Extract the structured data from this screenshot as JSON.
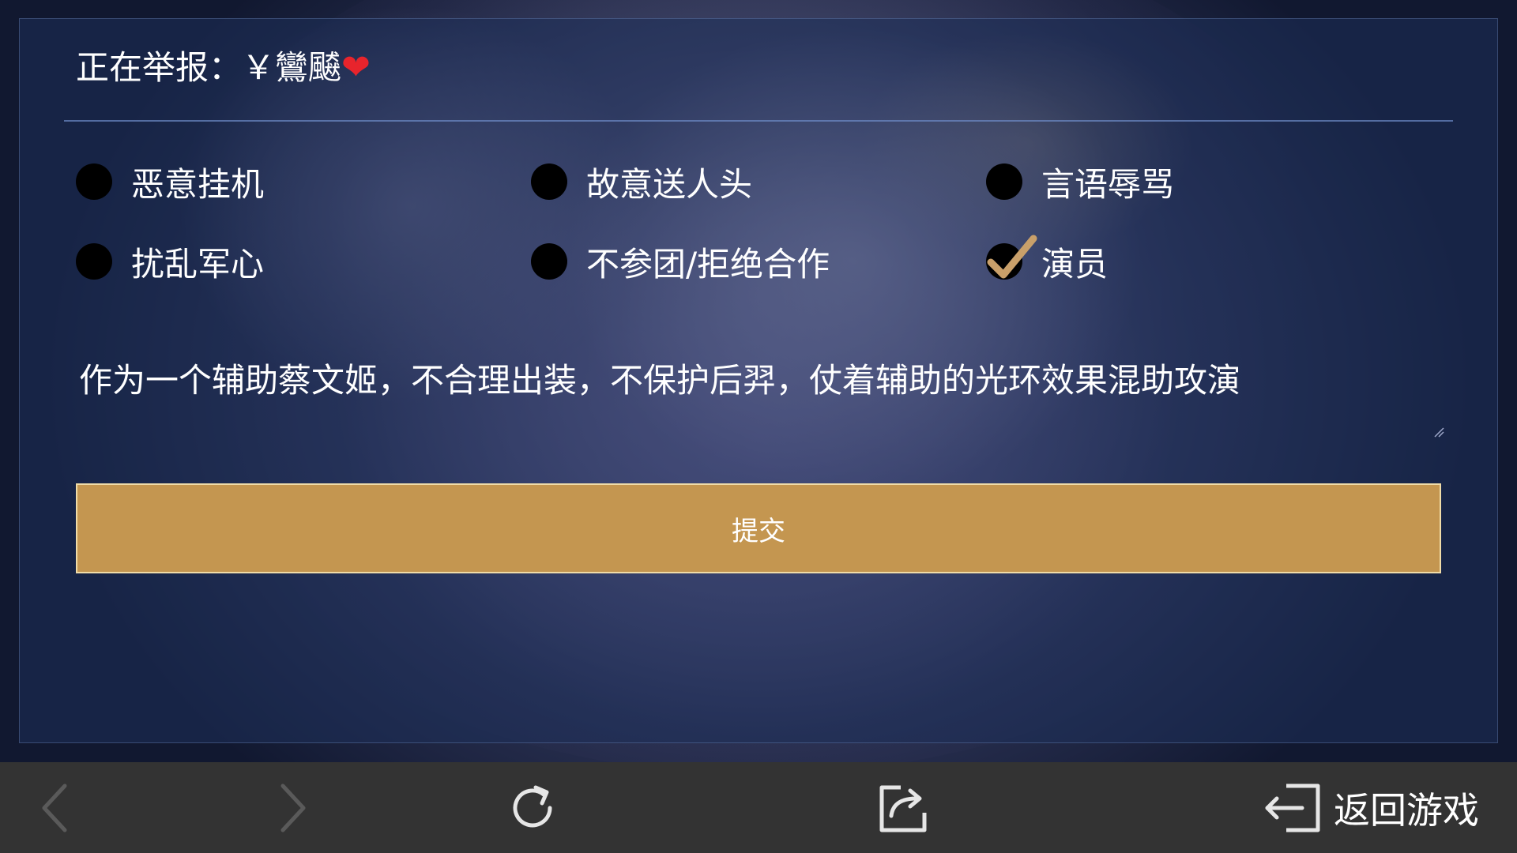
{
  "report": {
    "prefix": "正在举报：",
    "player_name": "￥鸞飇",
    "heart": "❤"
  },
  "options": [
    {
      "label": "恶意挂机",
      "checked": false
    },
    {
      "label": "故意送人头",
      "checked": false
    },
    {
      "label": "言语辱骂",
      "checked": false
    },
    {
      "label": "扰乱军心",
      "checked": false
    },
    {
      "label": "不参团/拒绝合作",
      "checked": false
    },
    {
      "label": "演员",
      "checked": true
    }
  ],
  "reason": {
    "value": "作为一个辅助蔡文姬，不合理出装，不保护后羿，仗着辅助的光环效果混助攻演"
  },
  "submit_label": "提交",
  "toolbar": {
    "back_icon": "chevron-left-icon",
    "forward_icon": "chevron-right-icon",
    "refresh_icon": "refresh-icon",
    "share_icon": "share-icon",
    "exit_icon": "exit-icon",
    "return_game_label": "返回游戏"
  },
  "colors": {
    "panel": "#1e305a",
    "submit": "#c49650",
    "check": "#c9a06a",
    "toolbar": "#333333"
  }
}
